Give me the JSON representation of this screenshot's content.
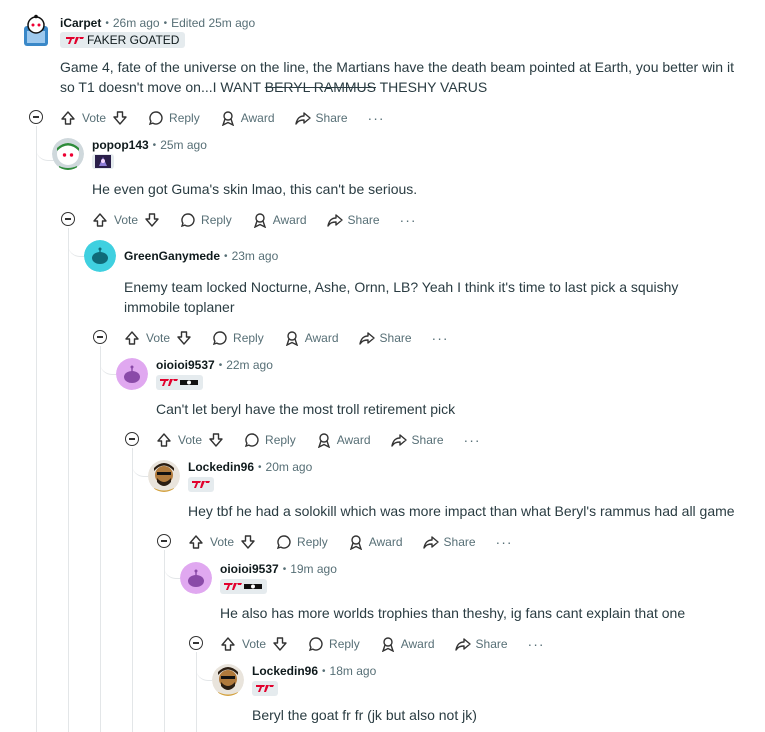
{
  "actions": {
    "vote": "Vote",
    "reply": "Reply",
    "award": "Award",
    "share": "Share",
    "more": "···"
  },
  "colors": {
    "t1_red": "#e2012d",
    "meta_gray": "#576f76",
    "thread_line": "#e3e6e8",
    "flair_bg": "#e5ebee"
  },
  "comments": [
    {
      "username": "iCarpet",
      "time": "26m ago",
      "edited": "Edited 25m ago",
      "flair": "FAKER GOATED",
      "body_part1": "Game 4, fate of the universe on the line, the Martians have the death beam pointed at Earth, you better win it so T1 doesn't move on...I WANT ",
      "body_strike": "BERYL RAMMUS",
      "body_part2": " THESHY VARUS"
    },
    {
      "username": "popop143",
      "time": "25m ago",
      "body": "He even got Guma's skin lmao, this can't be serious."
    },
    {
      "username": "GreenGanymede",
      "time": "23m ago",
      "body": "Enemy team locked Nocturne, Ashe, Ornn, LB? Yeah I think it's time to last pick a squishy immobile toplaner"
    },
    {
      "username": "oioioi9537",
      "time": "22m ago",
      "body": "Can't let beryl have the most troll retirement pick"
    },
    {
      "username": "Lockedin96",
      "time": "20m ago",
      "body": "Hey tbf he had a solokill which was more impact than what Beryl's rammus had all game"
    },
    {
      "username": "oioioi9537",
      "time": "19m ago",
      "body": "He also has more worlds trophies than theshy, ig fans cant explain that one"
    },
    {
      "username": "Lockedin96",
      "time": "18m ago",
      "body": "Beryl the goat fr fr (jk but also not jk)"
    }
  ]
}
